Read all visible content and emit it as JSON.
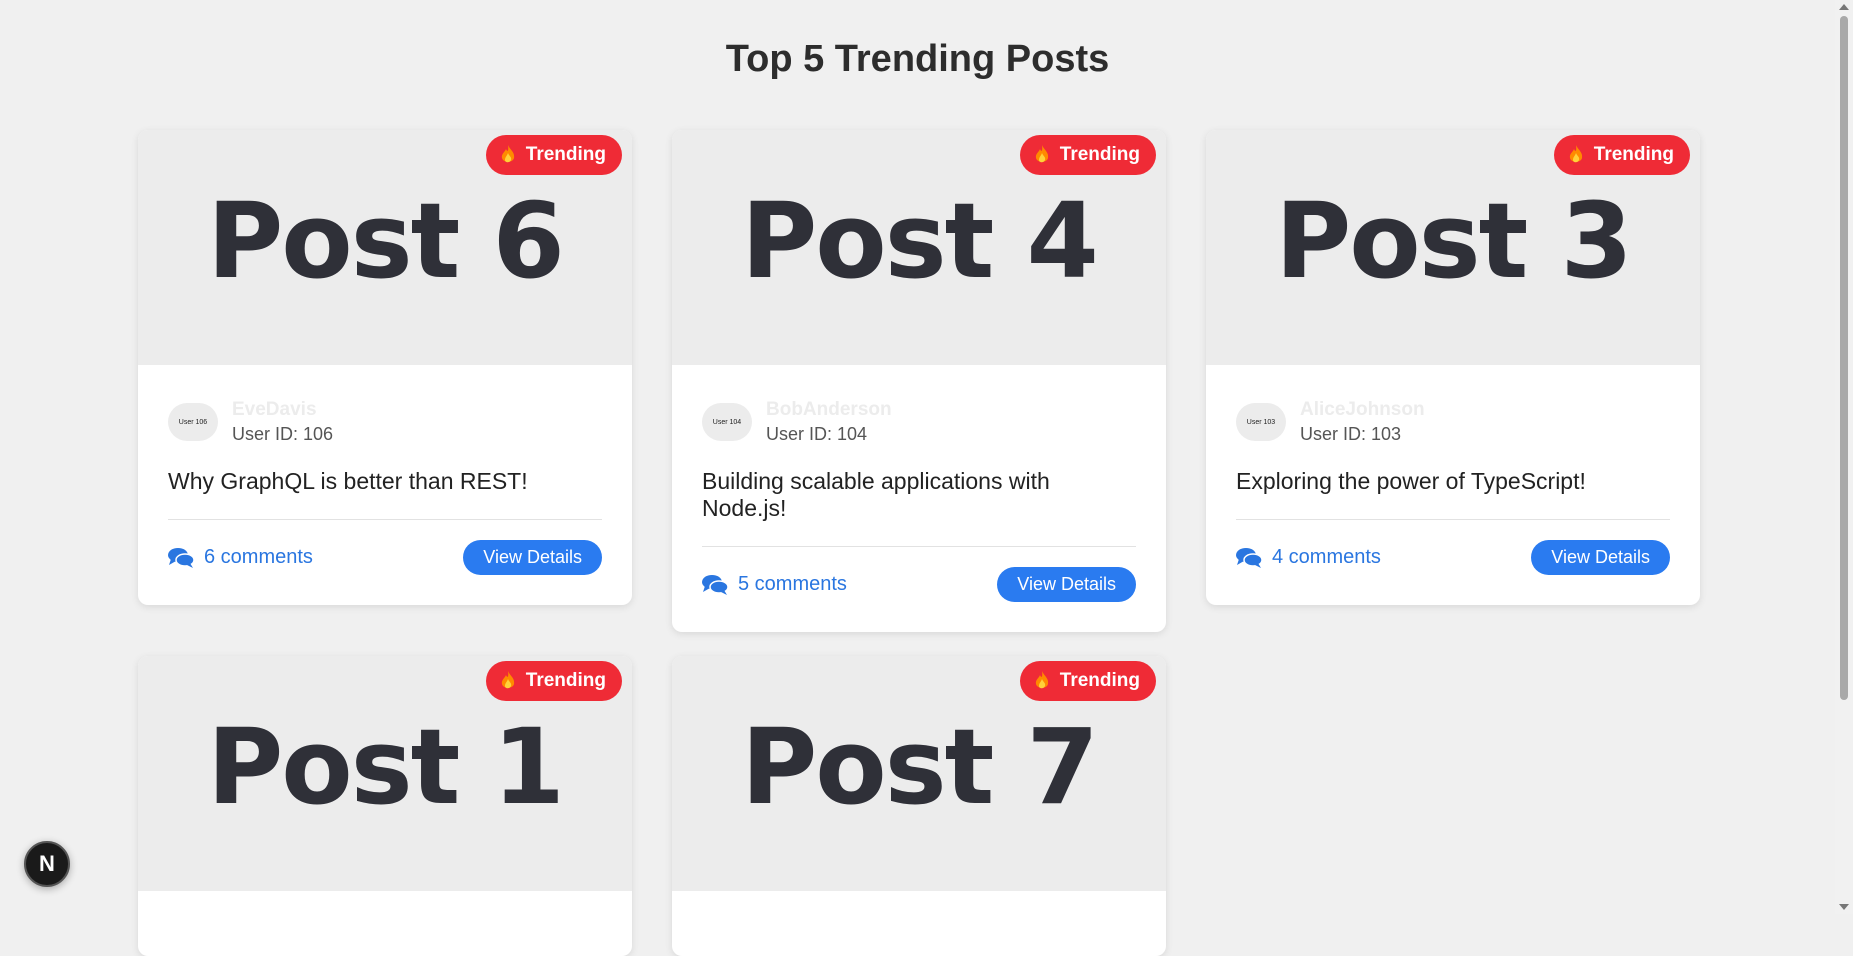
{
  "page": {
    "title": "Top 5 Trending Posts"
  },
  "badge_label": "Trending",
  "view_label": "View Details",
  "posts": [
    {
      "hero": "Post 6",
      "avatar": "User 106",
      "author": "EveDavis",
      "user_id": "User ID: 106",
      "text": "Why GraphQL is better than REST!",
      "comments": "6 comments"
    },
    {
      "hero": "Post 4",
      "avatar": "User 104",
      "author": "BobAnderson",
      "user_id": "User ID: 104",
      "text": "Building scalable applications with Node.js!",
      "comments": "5 comments"
    },
    {
      "hero": "Post 3",
      "avatar": "User 103",
      "author": "AliceJohnson",
      "user_id": "User ID: 103",
      "text": "Exploring the power of TypeScript!",
      "comments": "4 comments"
    },
    {
      "hero": "Post 1"
    },
    {
      "hero": "Post 7"
    }
  ],
  "dev_indicator": {
    "label": "N"
  },
  "colors": {
    "accent": "#2a7bf0",
    "badge": "#ef2b36",
    "background": "#f0f0f0"
  }
}
